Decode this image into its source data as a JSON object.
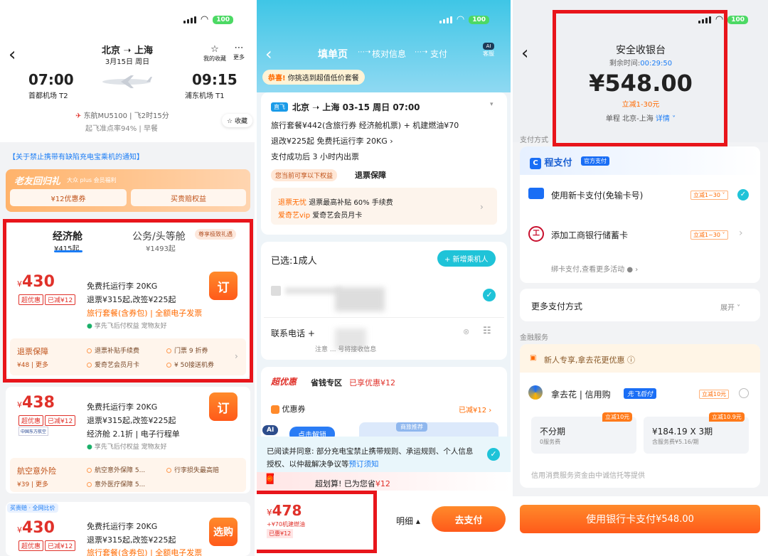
{
  "p1": {
    "back": "‹",
    "route": "北京 ➝ 上海",
    "date": "3月15日  周日",
    "fav_top": "我的收藏",
    "more": "更多",
    "dep_time": "07:00",
    "dep_airport": "首都机场 T2",
    "arr_time": "09:15",
    "arr_airport": "浦东机场 T1",
    "flight": "东航MU5100 | 飞2时15分",
    "ontime": "起飞准点率94% | 早餐",
    "fav": "收藏",
    "notice": "【关于禁止携带有缺陷充电宝乘机的通知】",
    "promo_title": "老友回归礼",
    "promo_sub": "大众 plus 会员福利",
    "promo_btn1": "¥12优惠券",
    "promo_btn2": "买贵赔权益",
    "cabin1": "经济舱",
    "cabin1_price": "¥415起",
    "cabin2": "公务/头等舱",
    "cabin2_price": "¥1493起",
    "cabin2_badge": "尊享极致礼遇",
    "offers": [
      {
        "price": "430",
        "tag1": "超优惠",
        "tag2": "已减¥12",
        "l1": "免费托运行李 20KG",
        "l2": "退票¥315起,改签¥225起",
        "l3a": "旅行套餐(含券包)",
        "l3b": "全额电子发票",
        "l4": "享先飞后付权益   宠物友好",
        "btn": "订",
        "bot_title": "退票保障",
        "bot_price": "¥48",
        "bot_more": "更多",
        "b1": "退票补贴手续费",
        "b2": "门票 9 折券",
        "b3": "爱奇艺会员月卡",
        "b4": "¥ 50接送机券"
      },
      {
        "price": "438",
        "tag1": "超优惠",
        "tag2": "已减¥12",
        "logo": "中国东方航空",
        "l1": "免费托运行李 20KG",
        "l2": "退票¥315起,改签¥225起",
        "l3a": "经济舱 2.1折",
        "l3b": "电子行程单",
        "l4": "享先飞后付权益   宠物友好",
        "btn": "订",
        "bot_title": "航空意外险",
        "bot_price": "¥39",
        "bot_more": "更多",
        "b1": "航空意外保障 5...",
        "b2": "行李损失最高赔",
        "b3": "意外医疗保障 5..."
      },
      {
        "tag_top": "买贵赔 · 全网比价",
        "price": "430",
        "tag1": "超优惠",
        "tag2": "已减¥12",
        "l1": "免费托运行李 20KG",
        "l2": "退票¥315起,改签¥225起",
        "l3a": "旅行套餐(含券包)",
        "l3b": "全额电子发票",
        "btn": "选购"
      }
    ]
  },
  "p2": {
    "back": "‹",
    "step1": "填单页",
    "step2": "核对信息",
    "step3": "支付",
    "service": "客服",
    "congrats": "恭喜!",
    "congrats_text": "你挑选到超值低价套餐",
    "flight_badge": "直飞",
    "flight": "北京 ➝ 上海   03-15  周日   07:00",
    "pkg": "旅行套餐¥442(含旅行券 经济舱机票) + 机建燃油¥70",
    "refund": "退改¥225起     免费托运行李 20KG ›",
    "ticket": "支付成功后 3 小时内出票",
    "rights_tag": "您当前可享以下权益",
    "rights": "退票保障",
    "r1a": "退票无忧",
    "r1b": "退票最高补贴 60% 手续费",
    "r2a": "爱奇艺vip",
    "r2b": "爱奇艺会员月卡",
    "selected": "已选:1成人",
    "add_pax": "+ 新增乘机人",
    "contact": "联系电话  +",
    "note": "注意 ... 号将接收信息",
    "deal_logo": "超优惠",
    "deal_zone": "省钱专区",
    "deal_enjoy": "已享优惠¥12",
    "coupon": "优惠券",
    "coupon_val": "已减¥12 ›",
    "ai": "AI",
    "unlock": "点击解锁",
    "rec": "商旅推荐",
    "agree": "已阅读并同意: 部分充电宝禁止携带规则、承运规则、个人信息授权、以仲裁解决争议等",
    "agree_link": "预订须知",
    "saved": "超划算! 已为您省",
    "saved_amt": "¥12",
    "total": "478",
    "total_sub": "+¥70机建燃油",
    "total_tag": "已惠¥12",
    "detail": "明细 ▴",
    "pay": "去支付"
  },
  "p3": {
    "back": "‹",
    "title": "安全收银台",
    "remain_label": "剩余时间:",
    "remain": "00:29:50",
    "amount": "¥548.00",
    "discount": "立减1-30元",
    "trip": "单程 北京-上海",
    "detail": "详情 ˅",
    "pay_method": "支付方式",
    "chengpay": "程支付",
    "official": "官方支付",
    "opt1": "使用新卡支付(免输卡号)",
    "opt1_tag": "立减1~30 ˅",
    "opt2": "添加工商银行储蓄卡",
    "opt2_tag": "立减1~30 ˅",
    "bind": "绑卡支付,查看更多活动 ● ›",
    "more_pay": "更多支付方式",
    "expand": "展开 ˅",
    "finance": "金融服务",
    "newuser": "新人专享,拿去花更优惠 ⓘ",
    "nqh": "拿去花 | 信用购",
    "xf": "先飞后付",
    "nqh_tag": "立减10元",
    "inst1": "不分期",
    "inst1_sub": "0服务费",
    "inst1_tag": "立减10元",
    "inst2": "¥184.19 X 3期",
    "inst2_sub": "含服务费¥5.16/期",
    "inst2_tag": "立减10.9元",
    "credit_note": "信用消费服务资金由中诚信托等提供",
    "pay_btn": "使用银行卡支付",
    "pay_amt": "¥548.00"
  },
  "status": {
    "battery": "100"
  }
}
